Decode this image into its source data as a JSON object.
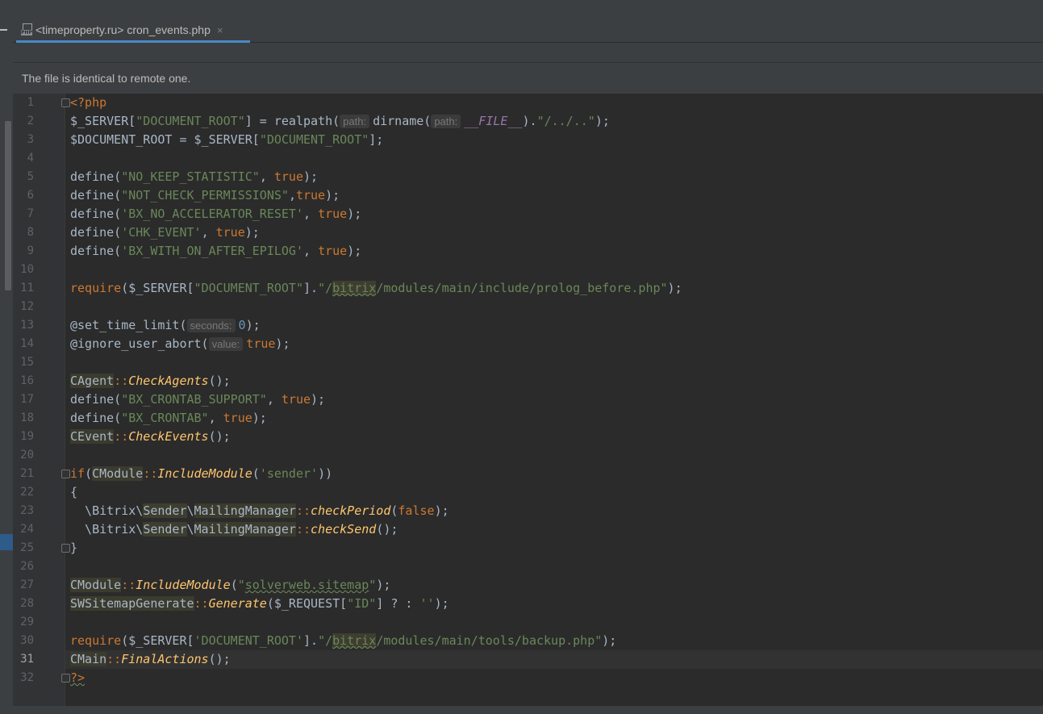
{
  "tab": {
    "label": "<timeproperty.ru> cron_events.php",
    "close": "×",
    "icon_text": "PHP"
  },
  "notice": "The file is identical to remote one.",
  "current_line": 31,
  "lines": [
    {
      "n": "1",
      "segs": [
        {
          "t": "<?php",
          "c": "kw"
        }
      ]
    },
    {
      "n": "2",
      "segs": [
        {
          "t": "$_SERVER["
        },
        {
          "t": "\"DOCUMENT_ROOT\"",
          "c": "str"
        },
        {
          "t": "] = realpath("
        },
        {
          "t": "path:",
          "c": "hint"
        },
        {
          "t": "dirname("
        },
        {
          "t": "path:",
          "c": "hint"
        },
        {
          "t": "__FILE__",
          "c": "mc"
        },
        {
          "t": ")."
        },
        {
          "t": "\"/../..\"",
          "c": "str"
        },
        {
          "t": ");"
        }
      ]
    },
    {
      "n": "3",
      "segs": [
        {
          "t": "$DOCUMENT_ROOT = $_SERVER["
        },
        {
          "t": "\"DOCUMENT_ROOT\"",
          "c": "str"
        },
        {
          "t": "];"
        }
      ]
    },
    {
      "n": "4",
      "segs": []
    },
    {
      "n": "5",
      "segs": [
        {
          "t": "define("
        },
        {
          "t": "\"NO_KEEP_STATISTIC\"",
          "c": "str"
        },
        {
          "t": ", "
        },
        {
          "t": "true",
          "c": "kw"
        },
        {
          "t": ");"
        }
      ]
    },
    {
      "n": "6",
      "segs": [
        {
          "t": "define("
        },
        {
          "t": "\"NOT_CHECK_PERMISSIONS\"",
          "c": "str"
        },
        {
          "t": ","
        },
        {
          "t": "true",
          "c": "kw"
        },
        {
          "t": ");"
        }
      ]
    },
    {
      "n": "7",
      "segs": [
        {
          "t": "define("
        },
        {
          "t": "'BX_NO_ACCELERATOR_RESET'",
          "c": "str"
        },
        {
          "t": ", "
        },
        {
          "t": "true",
          "c": "kw"
        },
        {
          "t": ");"
        }
      ]
    },
    {
      "n": "8",
      "segs": [
        {
          "t": "define("
        },
        {
          "t": "'CHK_EVENT'",
          "c": "str"
        },
        {
          "t": ", "
        },
        {
          "t": "true",
          "c": "kw"
        },
        {
          "t": ");"
        }
      ]
    },
    {
      "n": "9",
      "segs": [
        {
          "t": "define("
        },
        {
          "t": "'BX_WITH_ON_AFTER_EPILOG'",
          "c": "str"
        },
        {
          "t": ", "
        },
        {
          "t": "true",
          "c": "kw"
        },
        {
          "t": ");"
        }
      ]
    },
    {
      "n": "10",
      "segs": []
    },
    {
      "n": "11",
      "segs": [
        {
          "t": "require",
          "c": "kw"
        },
        {
          "t": "($_SERVER["
        },
        {
          "t": "\"DOCUMENT_ROOT\"",
          "c": "str"
        },
        {
          "t": "]."
        },
        {
          "t": "\"/",
          "c": "str"
        },
        {
          "t": "bitrix",
          "c": "str hl wavy"
        },
        {
          "t": "/modules/main/include/prolog_before.php\"",
          "c": "str"
        },
        {
          "t": ");"
        }
      ]
    },
    {
      "n": "12",
      "segs": []
    },
    {
      "n": "13",
      "segs": [
        {
          "t": "@set_time_limit("
        },
        {
          "t": "seconds:",
          "c": "hint"
        },
        {
          "t": "0",
          "c": "num"
        },
        {
          "t": ");"
        }
      ]
    },
    {
      "n": "14",
      "segs": [
        {
          "t": "@ignore_user_abort("
        },
        {
          "t": "value:",
          "c": "hint"
        },
        {
          "t": "true",
          "c": "kw"
        },
        {
          "t": ");"
        }
      ]
    },
    {
      "n": "15",
      "segs": []
    },
    {
      "n": "16",
      "segs": [
        {
          "t": "CAgent",
          "c": "cls"
        },
        {
          "t": "::",
          "c": "kw"
        },
        {
          "t": "CheckAgents",
          "c": "meth"
        },
        {
          "t": "();"
        }
      ]
    },
    {
      "n": "17",
      "segs": [
        {
          "t": "define("
        },
        {
          "t": "\"BX_CRONTAB_SUPPORT\"",
          "c": "str"
        },
        {
          "t": ", "
        },
        {
          "t": "true",
          "c": "kw"
        },
        {
          "t": ");"
        }
      ]
    },
    {
      "n": "18",
      "segs": [
        {
          "t": "define("
        },
        {
          "t": "\"BX_CRONTAB\"",
          "c": "str"
        },
        {
          "t": ", "
        },
        {
          "t": "true",
          "c": "kw"
        },
        {
          "t": ");"
        }
      ]
    },
    {
      "n": "19",
      "segs": [
        {
          "t": "CEvent",
          "c": "cls"
        },
        {
          "t": "::",
          "c": "kw"
        },
        {
          "t": "CheckEvents",
          "c": "meth"
        },
        {
          "t": "();"
        }
      ]
    },
    {
      "n": "20",
      "segs": []
    },
    {
      "n": "21",
      "segs": [
        {
          "t": "if",
          "c": "kw"
        },
        {
          "t": "("
        },
        {
          "t": "CModule",
          "c": "cls"
        },
        {
          "t": "::",
          "c": "kw"
        },
        {
          "t": "IncludeModule",
          "c": "meth"
        },
        {
          "t": "("
        },
        {
          "t": "'sender'",
          "c": "str"
        },
        {
          "t": "))"
        }
      ]
    },
    {
      "n": "22",
      "segs": [
        {
          "t": "{"
        }
      ]
    },
    {
      "n": "23",
      "segs": [
        {
          "t": "  \\Bitrix\\"
        },
        {
          "t": "Sender",
          "c": "hl"
        },
        {
          "t": "\\"
        },
        {
          "t": "MailingManager",
          "c": "cls"
        },
        {
          "t": "::",
          "c": "kw"
        },
        {
          "t": "checkPeriod",
          "c": "meth"
        },
        {
          "t": "("
        },
        {
          "t": "false",
          "c": "kw"
        },
        {
          "t": ");"
        }
      ]
    },
    {
      "n": "24",
      "segs": [
        {
          "t": "  \\Bitrix\\"
        },
        {
          "t": "Sender",
          "c": "hl"
        },
        {
          "t": "\\"
        },
        {
          "t": "MailingManager",
          "c": "cls"
        },
        {
          "t": "::",
          "c": "kw"
        },
        {
          "t": "checkSend",
          "c": "meth"
        },
        {
          "t": "();"
        }
      ]
    },
    {
      "n": "25",
      "segs": [
        {
          "t": "}"
        }
      ]
    },
    {
      "n": "26",
      "segs": []
    },
    {
      "n": "27",
      "segs": [
        {
          "t": "CModule",
          "c": "cls"
        },
        {
          "t": "::",
          "c": "kw"
        },
        {
          "t": "IncludeModule",
          "c": "meth"
        },
        {
          "t": "("
        },
        {
          "t": "\"",
          "c": "str"
        },
        {
          "t": "solverweb.sitemap",
          "c": "str wavy"
        },
        {
          "t": "\"",
          "c": "str"
        },
        {
          "t": ");"
        }
      ]
    },
    {
      "n": "28",
      "segs": [
        {
          "t": "SWSitemapGenerate",
          "c": "cls"
        },
        {
          "t": "::",
          "c": "kw"
        },
        {
          "t": "Generate",
          "c": "meth"
        },
        {
          "t": "($_REQUEST["
        },
        {
          "t": "\"ID\"",
          "c": "str"
        },
        {
          "t": "] ? : "
        },
        {
          "t": "''",
          "c": "str"
        },
        {
          "t": ");"
        }
      ]
    },
    {
      "n": "29",
      "segs": []
    },
    {
      "n": "30",
      "segs": [
        {
          "t": "require",
          "c": "kw"
        },
        {
          "t": "($_SERVER["
        },
        {
          "t": "'DOCUMENT_ROOT'",
          "c": "str"
        },
        {
          "t": "]."
        },
        {
          "t": "\"/",
          "c": "str"
        },
        {
          "t": "bitrix",
          "c": "str hl wavy"
        },
        {
          "t": "/modules/main/tools/backup.php\"",
          "c": "str"
        },
        {
          "t": ");"
        }
      ]
    },
    {
      "n": "31",
      "segs": [
        {
          "t": "CMain",
          "c": "cls"
        },
        {
          "t": "::",
          "c": "kw"
        },
        {
          "t": "FinalActions",
          "c": "meth"
        },
        {
          "t": "();"
        }
      ]
    },
    {
      "n": "32",
      "segs": [
        {
          "t": "?>",
          "c": "kw wavy"
        }
      ]
    }
  ]
}
